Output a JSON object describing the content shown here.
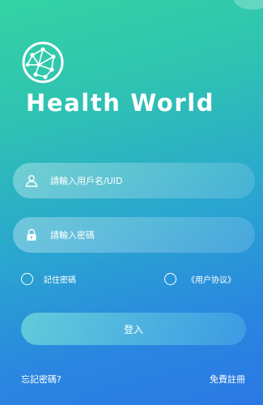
{
  "app": {
    "title": "Health World",
    "logo_icon": "globe-network-icon"
  },
  "login_form": {
    "username_placeholder": "請輸入用戶名/UID",
    "password_placeholder": "請輸入密碼",
    "user_icon": "user-icon",
    "lock_icon": "lock-icon",
    "remember_label": "記住密碼",
    "agreement_label": "《用户协议》",
    "login_label": "登入"
  },
  "footer": {
    "forgot_label": "忘記密碼?",
    "register_label": "免費註冊"
  },
  "colors": {
    "gradient_top": "#35d3a4",
    "gradient_bottom": "#2b79e4"
  }
}
